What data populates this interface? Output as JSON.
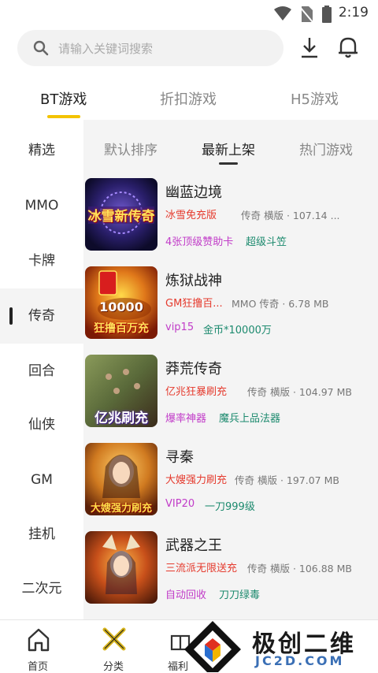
{
  "status_bar": {
    "time": "2:19"
  },
  "search": {
    "placeholder": "请输入关键词搜索",
    "icon": "search-icon"
  },
  "header_icons": [
    "download-icon",
    "bell-icon"
  ],
  "top_tabs": [
    {
      "label": "BT游戏",
      "active": true
    },
    {
      "label": "折扣游戏",
      "active": false
    },
    {
      "label": "H5游戏",
      "active": false
    }
  ],
  "sidebar": {
    "items": [
      {
        "label": "精选"
      },
      {
        "label": "MMO"
      },
      {
        "label": "卡牌"
      },
      {
        "label": "传奇",
        "active": true
      },
      {
        "label": "回合"
      },
      {
        "label": "仙侠"
      },
      {
        "label": "GM"
      },
      {
        "label": "挂机"
      },
      {
        "label": "二次元"
      }
    ]
  },
  "sort_tabs": [
    {
      "label": "默认排序",
      "active": false
    },
    {
      "label": "最新上架",
      "active": true
    },
    {
      "label": "热门游戏",
      "active": false
    }
  ],
  "games": [
    {
      "title": "幽蓝边境",
      "promo": "冰雪免充版",
      "meta": "传奇 横版 · 107.14 ...",
      "tag1": "4张顶级赞助卡",
      "tag2": "超级斗笠",
      "thumb_text": "冰雪新传奇"
    },
    {
      "title": "炼狱战神",
      "promo": "GM狂撸百...",
      "meta": "MMO 传奇 · 6.78 MB",
      "tag1": "vip15",
      "tag2": "金币*10000万",
      "thumb_text": "狂撸百万充",
      "thumb_num": "10000"
    },
    {
      "title": "莽荒传奇",
      "promo": "亿兆狂暴刷充",
      "meta": "传奇 横版 · 104.97 MB",
      "tag1": "爆率神器",
      "tag2": "魔兵上品法器",
      "thumb_text": "亿兆刷充"
    },
    {
      "title": "寻秦",
      "promo": "大嫂强力刷充",
      "meta": "传奇 横版 · 197.07 MB",
      "tag1": "VIP20",
      "tag2": "一刀999级",
      "thumb_text": "大嫂强力刷充"
    },
    {
      "title": "武器之王",
      "promo": "三流派无限送充",
      "meta": "传奇 横版 · 106.88 MB",
      "tag1": "自动回收",
      "tag2": "刀刀绿毒",
      "thumb_text": ""
    }
  ],
  "bottom_nav": [
    {
      "label": "首页",
      "icon": "home-icon"
    },
    {
      "label": "分类",
      "icon": "swords-icon"
    },
    {
      "label": "福利",
      "icon": "gift-icon"
    }
  ],
  "watermark": {
    "text": "极创二维",
    "url": "JC2D.COM"
  }
}
